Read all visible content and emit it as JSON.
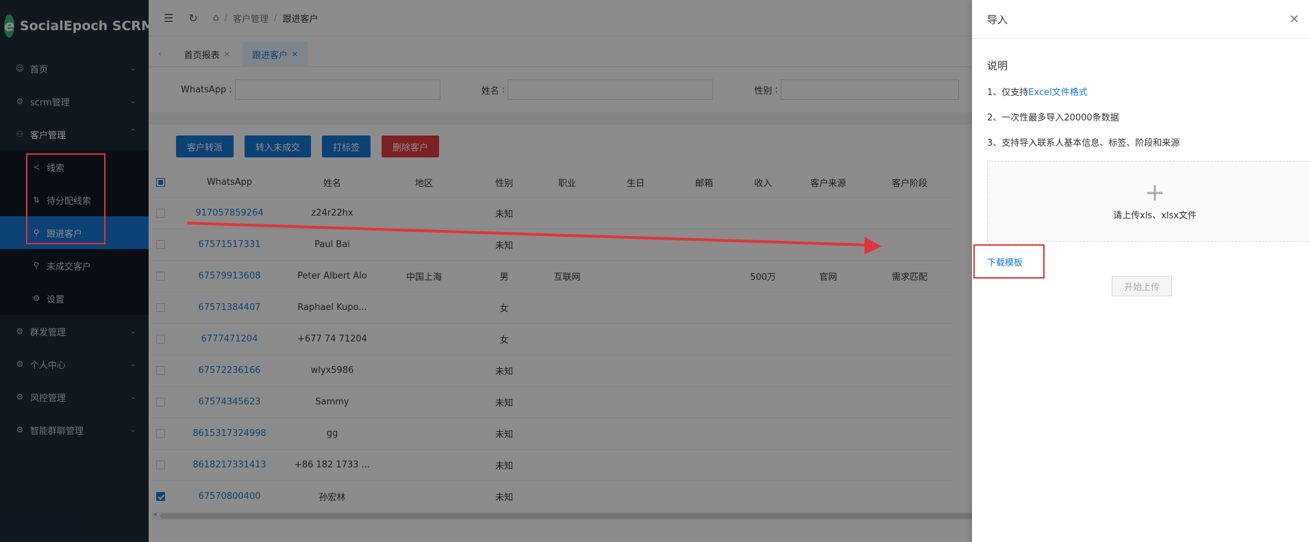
{
  "brand": {
    "name": "SocialEpoch SCRM",
    "mark": "e"
  },
  "sidebar": {
    "items": [
      {
        "label": "首页"
      },
      {
        "label": "scrm管理"
      },
      {
        "label": "客户管理"
      },
      {
        "label": "群发管理"
      },
      {
        "label": "个人中心"
      },
      {
        "label": "风控管理"
      },
      {
        "label": "智能群聊管理"
      }
    ],
    "sub": [
      {
        "label": "线索"
      },
      {
        "label": "待分配线索"
      },
      {
        "label": "跟进客户"
      },
      {
        "label": "未成交客户"
      },
      {
        "label": "设置"
      }
    ]
  },
  "breadcrumb": {
    "level1": "客户管理",
    "level2": "跟进客户"
  },
  "tabs": [
    {
      "label": "首页报表"
    },
    {
      "label": "跟进客户"
    }
  ],
  "filters": {
    "whatsapp": "WhatsApp",
    "name": "姓名",
    "gender": "性别"
  },
  "actions": {
    "transfer": "客户转派",
    "to_unclosed": "转入未成交",
    "tag": "打标签",
    "delete": "删除客户"
  },
  "table": {
    "headers": [
      "WhatsApp",
      "姓名",
      "地区",
      "性别",
      "职业",
      "生日",
      "邮箱",
      "收入",
      "客户来源",
      "客户阶段"
    ],
    "rows": [
      {
        "whatsapp": "917057859264",
        "name": "z24r22hx",
        "region": "",
        "gender": "未知",
        "job": "",
        "income": "",
        "source": "",
        "stage": "",
        "checked": false
      },
      {
        "whatsapp": "67571517331",
        "name": "Paul Bai",
        "region": "",
        "gender": "未知",
        "job": "",
        "income": "",
        "source": "",
        "stage": "",
        "checked": false
      },
      {
        "whatsapp": "67579913608",
        "name": "Peter Albert Alo",
        "region": "中国上海",
        "gender": "男",
        "job": "互联网",
        "income": "500万",
        "source": "官网",
        "stage": "需求匹配",
        "checked": false
      },
      {
        "whatsapp": "67571384407",
        "name": "Raphael Kupo...",
        "region": "",
        "gender": "女",
        "job": "",
        "income": "",
        "source": "",
        "stage": "",
        "checked": false
      },
      {
        "whatsapp": "6777471204",
        "name": "+677 74 71204",
        "region": "",
        "gender": "女",
        "job": "",
        "income": "",
        "source": "",
        "stage": "",
        "checked": false
      },
      {
        "whatsapp": "67572236166",
        "name": "wlyx5986",
        "region": "",
        "gender": "未知",
        "job": "",
        "income": "",
        "source": "",
        "stage": "",
        "checked": false
      },
      {
        "whatsapp": "67574345623",
        "name": "Sammy",
        "region": "",
        "gender": "未知",
        "job": "",
        "income": "",
        "source": "",
        "stage": "",
        "checked": false
      },
      {
        "whatsapp": "8615317324998",
        "name": "gg",
        "region": "",
        "gender": "未知",
        "job": "",
        "income": "",
        "source": "",
        "stage": "",
        "checked": false
      },
      {
        "whatsapp": "8618217331413",
        "name": "+86 182 1733 ...",
        "region": "",
        "gender": "未知",
        "job": "",
        "income": "",
        "source": "",
        "stage": "",
        "checked": false
      },
      {
        "whatsapp": "67570800400",
        "name": "孙宏林",
        "region": "",
        "gender": "未知",
        "job": "",
        "income": "",
        "source": "",
        "stage": "",
        "checked": true
      }
    ]
  },
  "drawer": {
    "title": "导入",
    "section_title": "说明",
    "line1_prefix": "1、仅支持",
    "line1_link": "Excel文件格式",
    "line2": "2、一次性最多导入20000条数据",
    "line3": "3、支持导入联系人基本信息、标签、阶段和来源",
    "upload_text": "请上传xls、xlsx文件",
    "download_template": "下载模板",
    "start_upload": "开始上传"
  },
  "colors": {
    "primary": "#1677d6",
    "danger": "#e23c3c",
    "sidebar_bg": "#1f2a3a",
    "annotation": "#e0353a"
  }
}
